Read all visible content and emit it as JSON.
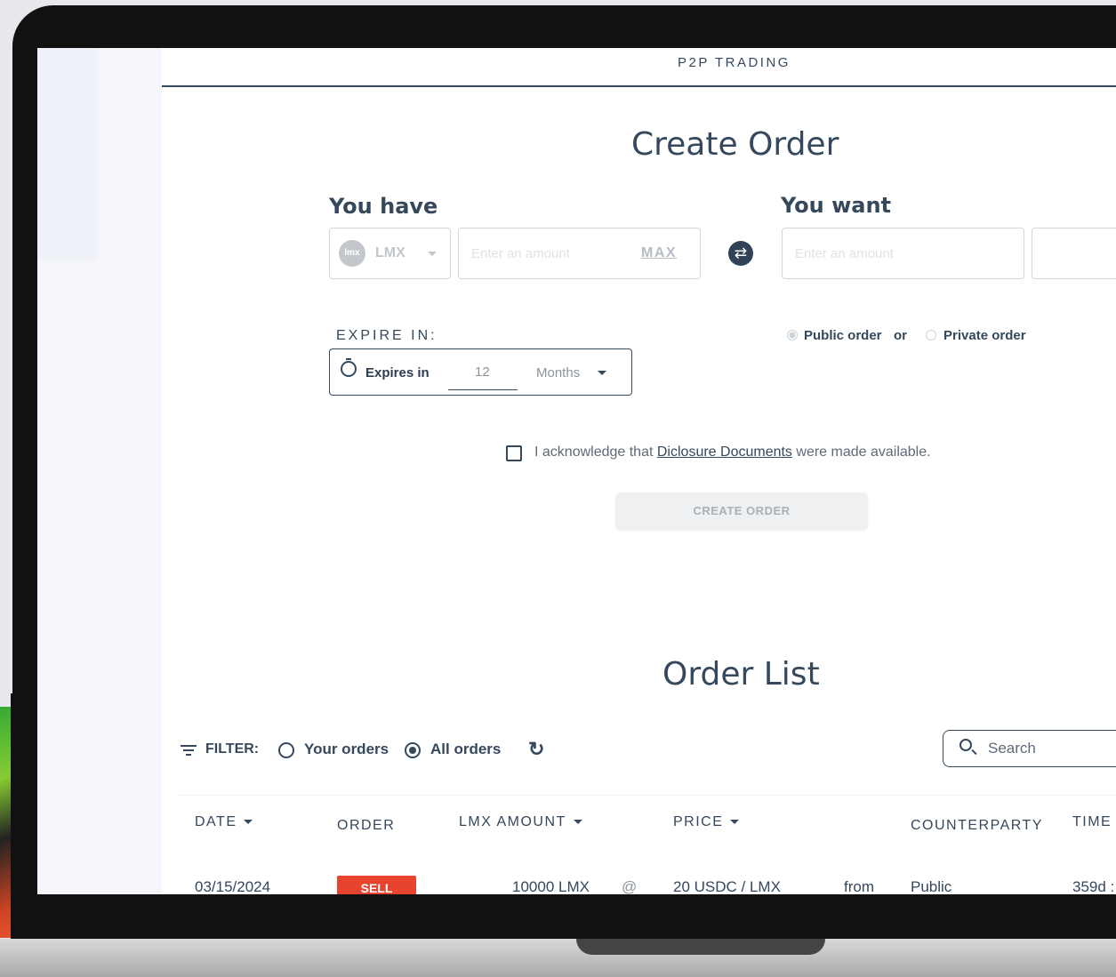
{
  "header": {
    "title": "P2P TRADING"
  },
  "create_order": {
    "title": "Create Order",
    "you_have": {
      "label": "You have",
      "token": "LMX",
      "token_icon_text": "lmx",
      "amount_placeholder": "Enter an amount",
      "max_label": "MAX"
    },
    "you_want": {
      "label": "You want",
      "amount_placeholder": "Enter an amount"
    },
    "expire": {
      "label": "EXPIRE IN:",
      "text": "Expires in",
      "value": "12",
      "unit": "Months"
    },
    "visibility": {
      "public_label": "Public order",
      "or_label": "or",
      "private_label": "Private order",
      "selected": "public"
    },
    "ack": {
      "prefix": "I acknowledge that ",
      "link": "Diclosure Documents",
      "suffix": " were made available."
    },
    "button": "CREATE ORDER"
  },
  "order_list": {
    "title": "Order List",
    "filter_label": "FILTER:",
    "filter_your": "Your orders",
    "filter_all": "All orders",
    "filter_selected": "all",
    "search_placeholder": "Search",
    "columns": [
      "DATE",
      "ORDER",
      "LMX AMOUNT",
      "PRICE",
      "COUNTERPARTY",
      "TIME"
    ],
    "rows": [
      {
        "date": "03/15/2024",
        "order": "SELL",
        "amount": "10000 LMX",
        "at": "@",
        "price": "20 USDC / LMX",
        "from": "from",
        "counterparty": "Public",
        "time": "359d :"
      }
    ]
  },
  "colors": {
    "primary": "#35485c",
    "sell": "#e8432f",
    "disabled": "#eef0f2"
  }
}
